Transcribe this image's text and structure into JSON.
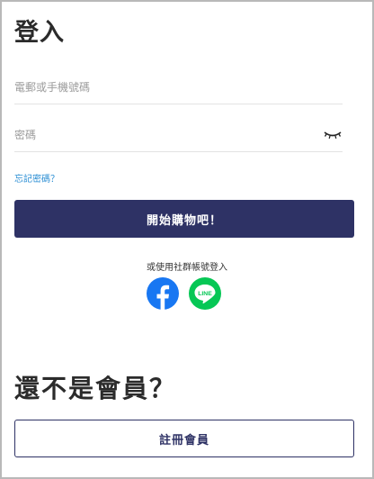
{
  "login": {
    "title": "登入",
    "phone_placeholder": "電郵或手機號碼",
    "password_placeholder": "密碼",
    "forgot_password": "忘記密碼？",
    "submit_label": "開始購物吧！"
  },
  "social": {
    "prompt": "或使用社群帳號登入",
    "providers": [
      {
        "name": "facebook-icon",
        "color": "#1877f2"
      },
      {
        "name": "line-icon",
        "color": "#06c755",
        "label": "LINE"
      }
    ]
  },
  "register": {
    "heading": "還不是會員？",
    "button_label": "註冊會員"
  },
  "colors": {
    "primary": "#2e3265",
    "link": "#2d8fd4"
  }
}
